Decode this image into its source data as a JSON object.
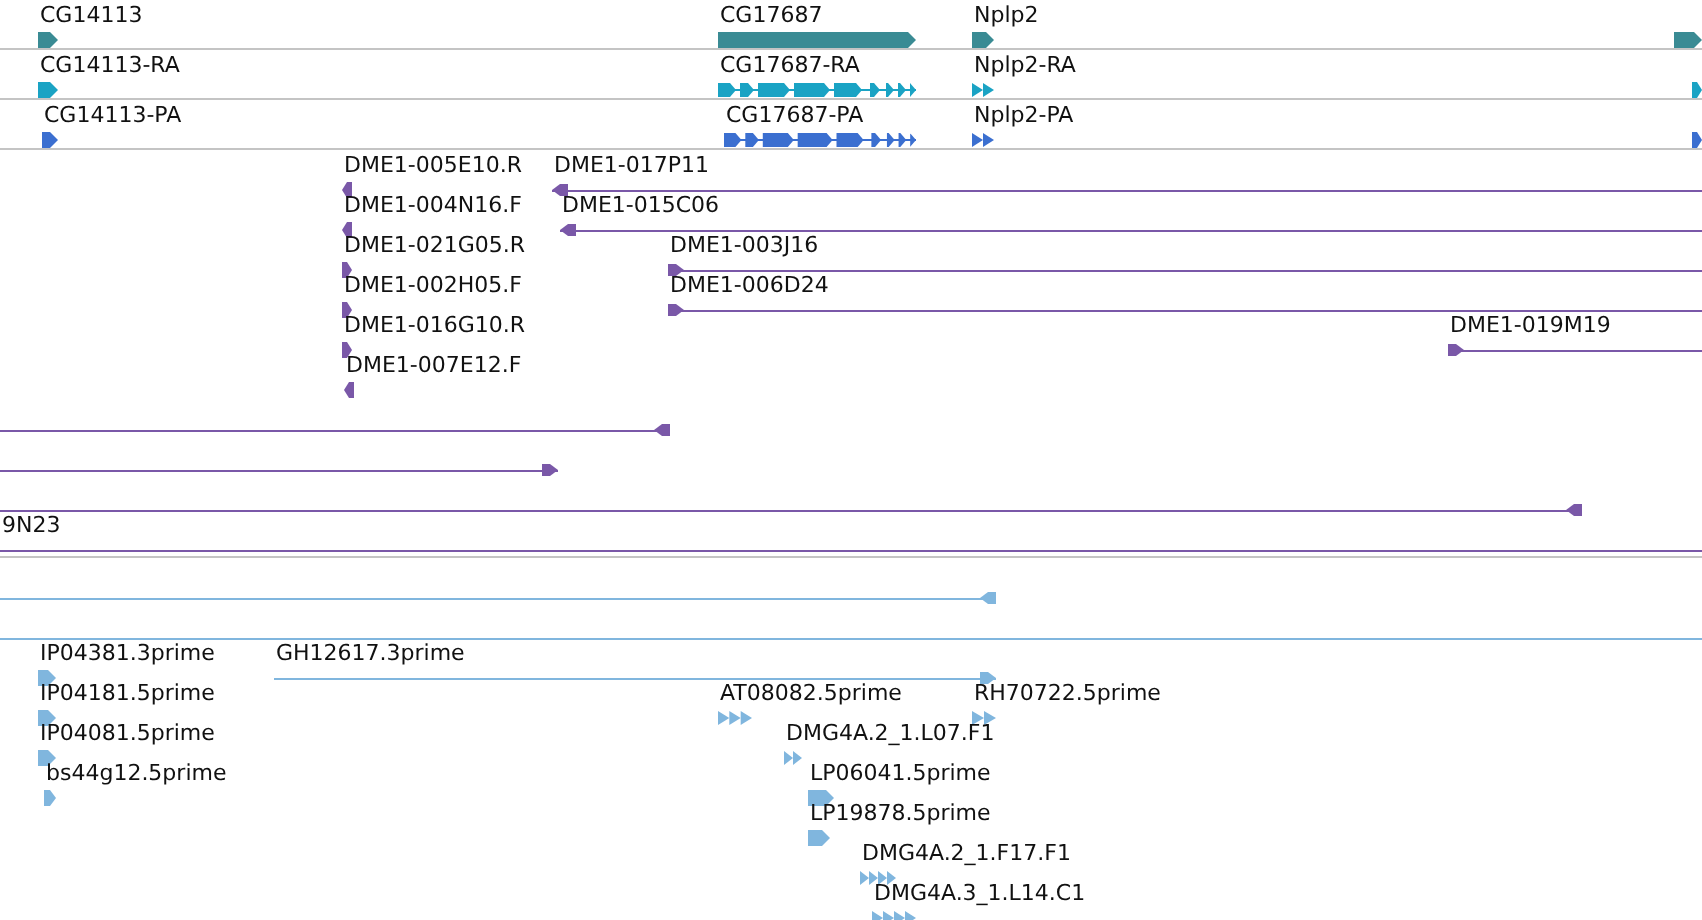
{
  "tracks": [
    {
      "color": "#3a8b94",
      "features": [
        {
          "kind": "block",
          "label": "CG14113",
          "reverse": false
        },
        {
          "kind": "block",
          "label": "CG17687",
          "reverse": false
        },
        {
          "kind": "block",
          "label": "Nplp2",
          "reverse": false
        },
        {
          "kind": "block",
          "reverse": false
        }
      ]
    },
    {
      "color": "#1aa3c4",
      "features": [
        {
          "kind": "block",
          "label": "CG14113-RA",
          "reverse": false
        },
        {
          "kind": "exons",
          "label": "CG17687-RA",
          "reverse": false
        },
        {
          "kind": "multi",
          "label": "Nplp2-RA",
          "reverse": false
        },
        {
          "kind": "block",
          "reverse": false
        }
      ]
    },
    {
      "color": "#3b6fd0",
      "features": [
        {
          "kind": "block",
          "label": "CG14113-PA",
          "reverse": false
        },
        {
          "kind": "exons",
          "label": "CG17687-PA",
          "reverse": false
        },
        {
          "kind": "multi",
          "label": "Nplp2-PA",
          "reverse": false
        },
        {
          "kind": "block",
          "reverse": false
        }
      ]
    },
    {
      "color": "#7a58a8",
      "features": [
        {
          "kind": "block",
          "label": "DME1-005E10.R",
          "reverse": true
        },
        {
          "kind": "span",
          "label": "DME1-017P11",
          "reverse": true
        },
        {
          "kind": "block",
          "label": "DME1-004N16.F",
          "reverse": true
        },
        {
          "kind": "span",
          "label": "DME1-015C06",
          "reverse": true
        },
        {
          "kind": "block",
          "label": "DME1-021G05.R",
          "reverse": false
        },
        {
          "kind": "span",
          "label": "DME1-003J16",
          "reverse": false
        },
        {
          "kind": "block",
          "label": "DME1-002H05.F",
          "reverse": false
        },
        {
          "kind": "span",
          "label": "DME1-006D24",
          "reverse": false
        },
        {
          "kind": "block",
          "label": "DME1-016G10.R",
          "reverse": false
        },
        {
          "kind": "span",
          "label": "DME1-019M19",
          "reverse": false
        },
        {
          "kind": "block",
          "label": "DME1-007E12.F",
          "reverse": true
        },
        {
          "kind": "span",
          "reverse": true
        },
        {
          "kind": "span",
          "reverse": false
        },
        {
          "kind": "span",
          "reverse": true
        },
        {
          "kind": "span",
          "label": "9N23"
        }
      ]
    },
    {
      "color": "#80b6de",
      "features": [
        {
          "kind": "span",
          "reverse": true
        },
        {
          "kind": "span"
        },
        {
          "kind": "block",
          "label": "IP04381.3prime",
          "reverse": false
        },
        {
          "kind": "span",
          "label": "GH12617.3prime",
          "reverse": false
        },
        {
          "kind": "block",
          "label": "IP04181.5prime",
          "reverse": false
        },
        {
          "kind": "multi",
          "label": "AT08082.5prime",
          "reverse": false
        },
        {
          "kind": "multi",
          "label": "RH70722.5prime",
          "reverse": false
        },
        {
          "kind": "block",
          "label": "IP04081.5prime",
          "reverse": false
        },
        {
          "kind": "multi",
          "label": "DMG4A.2_1.L07.F1",
          "reverse": false
        },
        {
          "kind": "block",
          "label": "bs44g12.5prime",
          "reverse": false
        },
        {
          "kind": "block",
          "label": "LP06041.5prime",
          "reverse": false
        },
        {
          "kind": "block",
          "label": "LP19878.5prime",
          "reverse": false
        },
        {
          "kind": "multi",
          "label": "DMG4A.2_1.F17.F1",
          "reverse": false
        },
        {
          "kind": "multi",
          "label": "DMG4A.3_1.L14.C1",
          "reverse": false
        }
      ]
    }
  ]
}
